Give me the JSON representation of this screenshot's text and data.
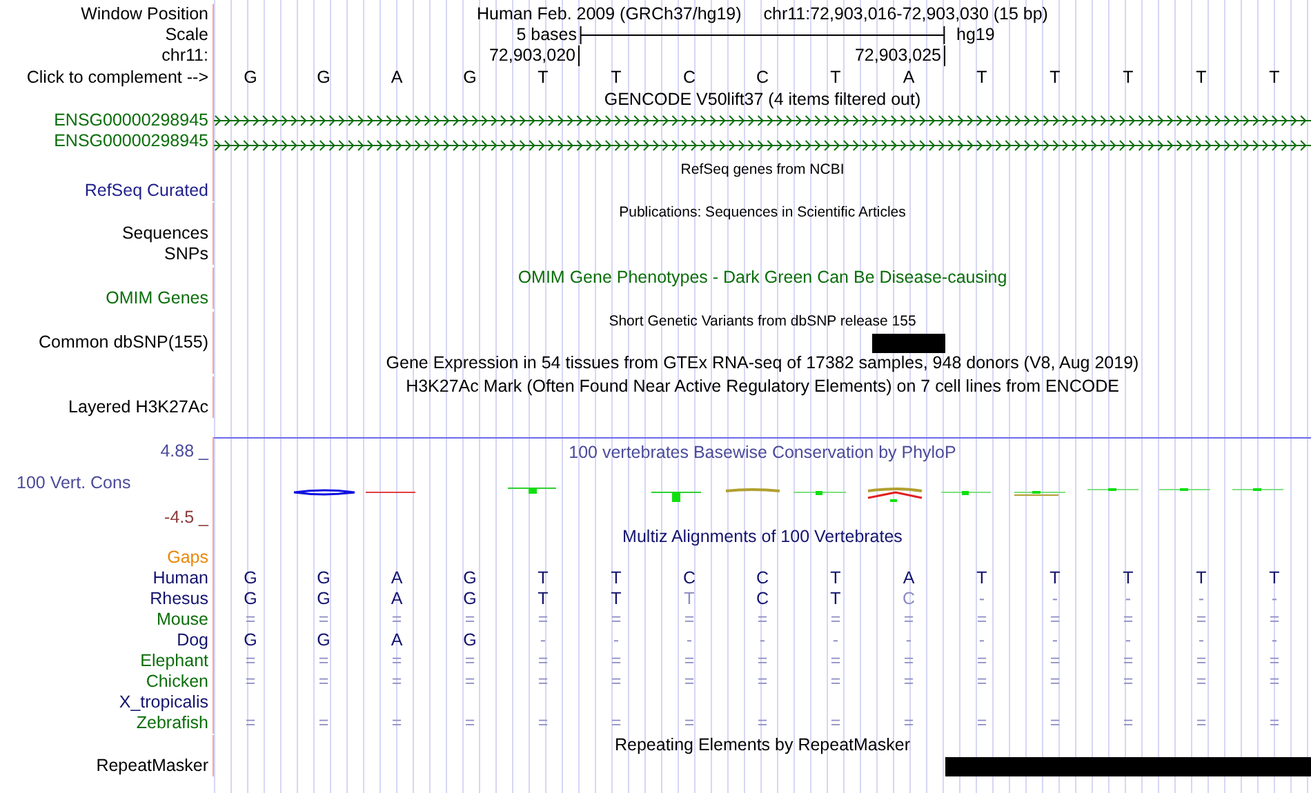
{
  "position": {
    "label": "Window Position",
    "assembly": "Human Feb. 2009 (GRCh37/hg19)",
    "range": "chr11:72,903,016-72,903,030 (15 bp)"
  },
  "scale": {
    "label": "Scale",
    "span": "5 bases",
    "db": "hg19"
  },
  "ruler": {
    "label": "chr11:",
    "ticks": [
      "72,903,020",
      "72,903,025"
    ]
  },
  "sequence": {
    "label": "Click to complement -->",
    "bases": [
      "G",
      "G",
      "A",
      "G",
      "T",
      "T",
      "C",
      "C",
      "T",
      "A",
      "T",
      "T",
      "T",
      "T",
      "T"
    ]
  },
  "tracks": [
    {
      "kind": "genes",
      "title": "GENCODE V50lift37 (4 items filtered out)",
      "color": "#000000",
      "labels": [
        {
          "text": "ENSG00000298945",
          "color": "#0a6e0a"
        },
        {
          "text": "ENSG00000298945",
          "color": "#0a6e0a"
        }
      ]
    },
    {
      "kind": "list",
      "title": "RefSeq genes from NCBI",
      "color": "#000000",
      "labels": [
        {
          "text": "RefSeq Curated",
          "color": "#1f1f8a"
        }
      ]
    },
    {
      "kind": "list",
      "title": "Publications: Sequences in Scientific Articles",
      "color": "#000000",
      "labels": [
        {
          "text": "Sequences",
          "color": "#000000"
        },
        {
          "text": "SNPs",
          "color": "#000000"
        }
      ]
    },
    {
      "kind": "list",
      "title": "OMIM Gene Phenotypes - Dark Green Can Be Disease-causing",
      "color": "#0a6e0a",
      "labels": [
        {
          "text": "OMIM Genes",
          "color": "#0a6e0a"
        }
      ]
    },
    {
      "kind": "blocks",
      "title": "Short Genetic Variants from dbSNP release 155",
      "color": "#000000",
      "labels": [
        {
          "text": "Common dbSNP(155)",
          "color": "#000000"
        }
      ],
      "covered": [
        false,
        false,
        false,
        false,
        false,
        false,
        false,
        false,
        false,
        true,
        false,
        false,
        false,
        false,
        false
      ]
    },
    {
      "kind": "list",
      "title": "Gene Expression in 54 tissues from GTEx RNA-seq of 17382 samples, 948 donors (V8, Aug 2019)",
      "color": "#000000"
    },
    {
      "kind": "layered",
      "title": "H3K27Ac Mark (Often Found Near Active Regulatory Elements) on 7 cell lines from ENCODE",
      "color": "#000000",
      "labels": [
        {
          "text": "Layered H3K27Ac",
          "color": "#000000"
        }
      ]
    },
    {
      "kind": "wiggle",
      "title": "100 vertebrates Basewise Conservation by PhyloP",
      "color": "#4b4b9b",
      "max": "4.88 _",
      "min": "-4.5 _",
      "labels": [
        {
          "text": "100 Vert. Cons",
          "color": "#4b4b9b"
        }
      ]
    },
    {
      "kind": "alignment",
      "title": "Multiz Alignments of 100 Vertebrates",
      "color": "#14146e",
      "gaps": {
        "text": "Gaps",
        "color": "#e8870a"
      },
      "species": [
        {
          "text": "Human",
          "color": "#14146e",
          "cells": [
            "G",
            "G",
            "A",
            "G",
            "T",
            "T",
            "C",
            "C",
            "T",
            "A",
            "T",
            "T",
            "T",
            "T",
            "T"
          ],
          "faded": [
            false,
            false,
            false,
            false,
            false,
            false,
            false,
            false,
            false,
            false,
            false,
            false,
            false,
            false,
            false
          ]
        },
        {
          "text": "Rhesus",
          "color": "#14146e",
          "cells": [
            "G",
            "G",
            "A",
            "G",
            "T",
            "T",
            "T",
            "C",
            "T",
            "C",
            "-",
            "-",
            "-",
            "-",
            "-"
          ],
          "faded": [
            false,
            false,
            false,
            false,
            false,
            false,
            true,
            false,
            false,
            true,
            true,
            true,
            true,
            true,
            true
          ]
        },
        {
          "text": "Mouse",
          "color": "#0a6e0a",
          "cells": [
            "=",
            "=",
            "=",
            "=",
            "=",
            "=",
            "=",
            "=",
            "=",
            "=",
            "=",
            "=",
            "=",
            "=",
            "="
          ],
          "faded": [
            true,
            true,
            true,
            true,
            true,
            true,
            true,
            true,
            true,
            true,
            true,
            true,
            true,
            true,
            true
          ]
        },
        {
          "text": "Dog",
          "color": "#14146e",
          "cells": [
            "G",
            "G",
            "A",
            "G",
            "-",
            "-",
            "-",
            "-",
            "-",
            "-",
            "-",
            "-",
            "-",
            "-",
            "-"
          ],
          "faded": [
            false,
            false,
            false,
            false,
            true,
            true,
            true,
            true,
            true,
            true,
            true,
            true,
            true,
            true,
            true
          ]
        },
        {
          "text": "Elephant",
          "color": "#0a6e0a",
          "cells": [
            "=",
            "=",
            "=",
            "=",
            "=",
            "=",
            "=",
            "=",
            "=",
            "=",
            "=",
            "=",
            "=",
            "=",
            "="
          ],
          "faded": [
            true,
            true,
            true,
            true,
            true,
            true,
            true,
            true,
            true,
            true,
            true,
            true,
            true,
            true,
            true
          ]
        },
        {
          "text": "Chicken",
          "color": "#0a6e0a",
          "cells": [
            "=",
            "=",
            "=",
            "=",
            "=",
            "=",
            "=",
            "=",
            "=",
            "=",
            "=",
            "=",
            "=",
            "=",
            "="
          ],
          "faded": [
            true,
            true,
            true,
            true,
            true,
            true,
            true,
            true,
            true,
            true,
            true,
            true,
            true,
            true,
            true
          ]
        },
        {
          "text": "X_tropicalis",
          "color": "#14146e"
        },
        {
          "text": "Zebrafish",
          "color": "#0a6e0a",
          "cells": [
            "=",
            "=",
            "=",
            "=",
            "=",
            "=",
            "=",
            "=",
            "=",
            "=",
            "=",
            "=",
            "=",
            "=",
            "="
          ],
          "faded": [
            true,
            true,
            true,
            true,
            true,
            true,
            true,
            true,
            true,
            true,
            true,
            true,
            true,
            true,
            true
          ]
        }
      ]
    },
    {
      "kind": "blocks",
      "title": "Repeating Elements by RepeatMasker",
      "color": "#000000",
      "labels": [
        {
          "text": "RepeatMasker",
          "color": "#000000"
        }
      ],
      "covered": [
        false,
        false,
        false,
        false,
        false,
        false,
        false,
        false,
        false,
        false,
        true,
        true,
        true,
        true,
        true
      ]
    }
  ]
}
